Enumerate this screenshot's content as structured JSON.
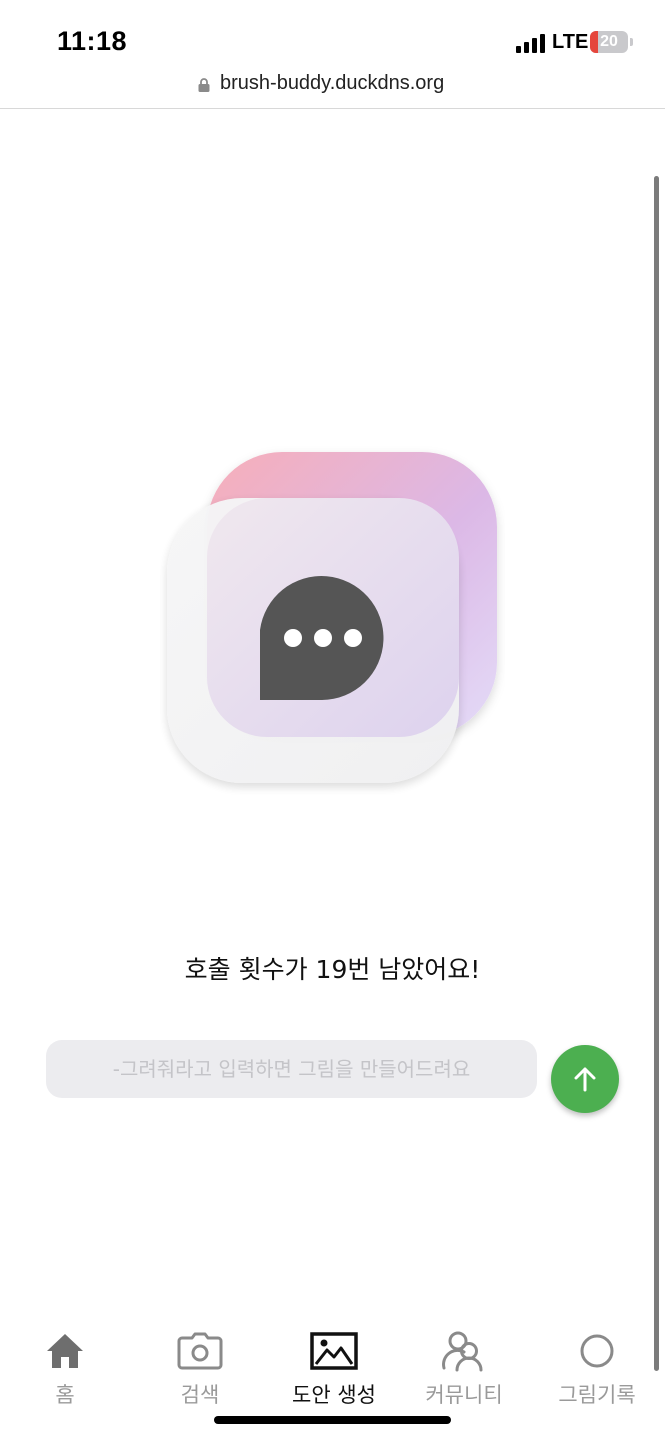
{
  "status_bar": {
    "time": "11:18",
    "network": "LTE",
    "battery_level": "20",
    "battery_fraction": 0.2,
    "battery_color": "#e5463c"
  },
  "browser": {
    "url": "brush-buddy.duckdns.org",
    "lock_icon": "lock-icon"
  },
  "main": {
    "illustration_icon": "chat-bubble-icon",
    "quota_message": "호출 횟수가 19번 남았어요!",
    "prompt_placeholder": "-그려줘라고 입력하면 그림을 만들어드려요",
    "prompt_value": "",
    "send_icon": "arrow-up-icon",
    "accent_color": "#4caf50"
  },
  "bottom_nav": {
    "items": [
      {
        "label": "홈",
        "icon": "home-icon",
        "active": false
      },
      {
        "label": "검색",
        "icon": "camera-icon",
        "active": false
      },
      {
        "label": "도안 생성",
        "icon": "image-icon",
        "active": true
      },
      {
        "label": "커뮤니티",
        "icon": "community-icon",
        "active": false
      },
      {
        "label": "그림기록",
        "icon": "circle-icon",
        "active": false
      }
    ]
  }
}
